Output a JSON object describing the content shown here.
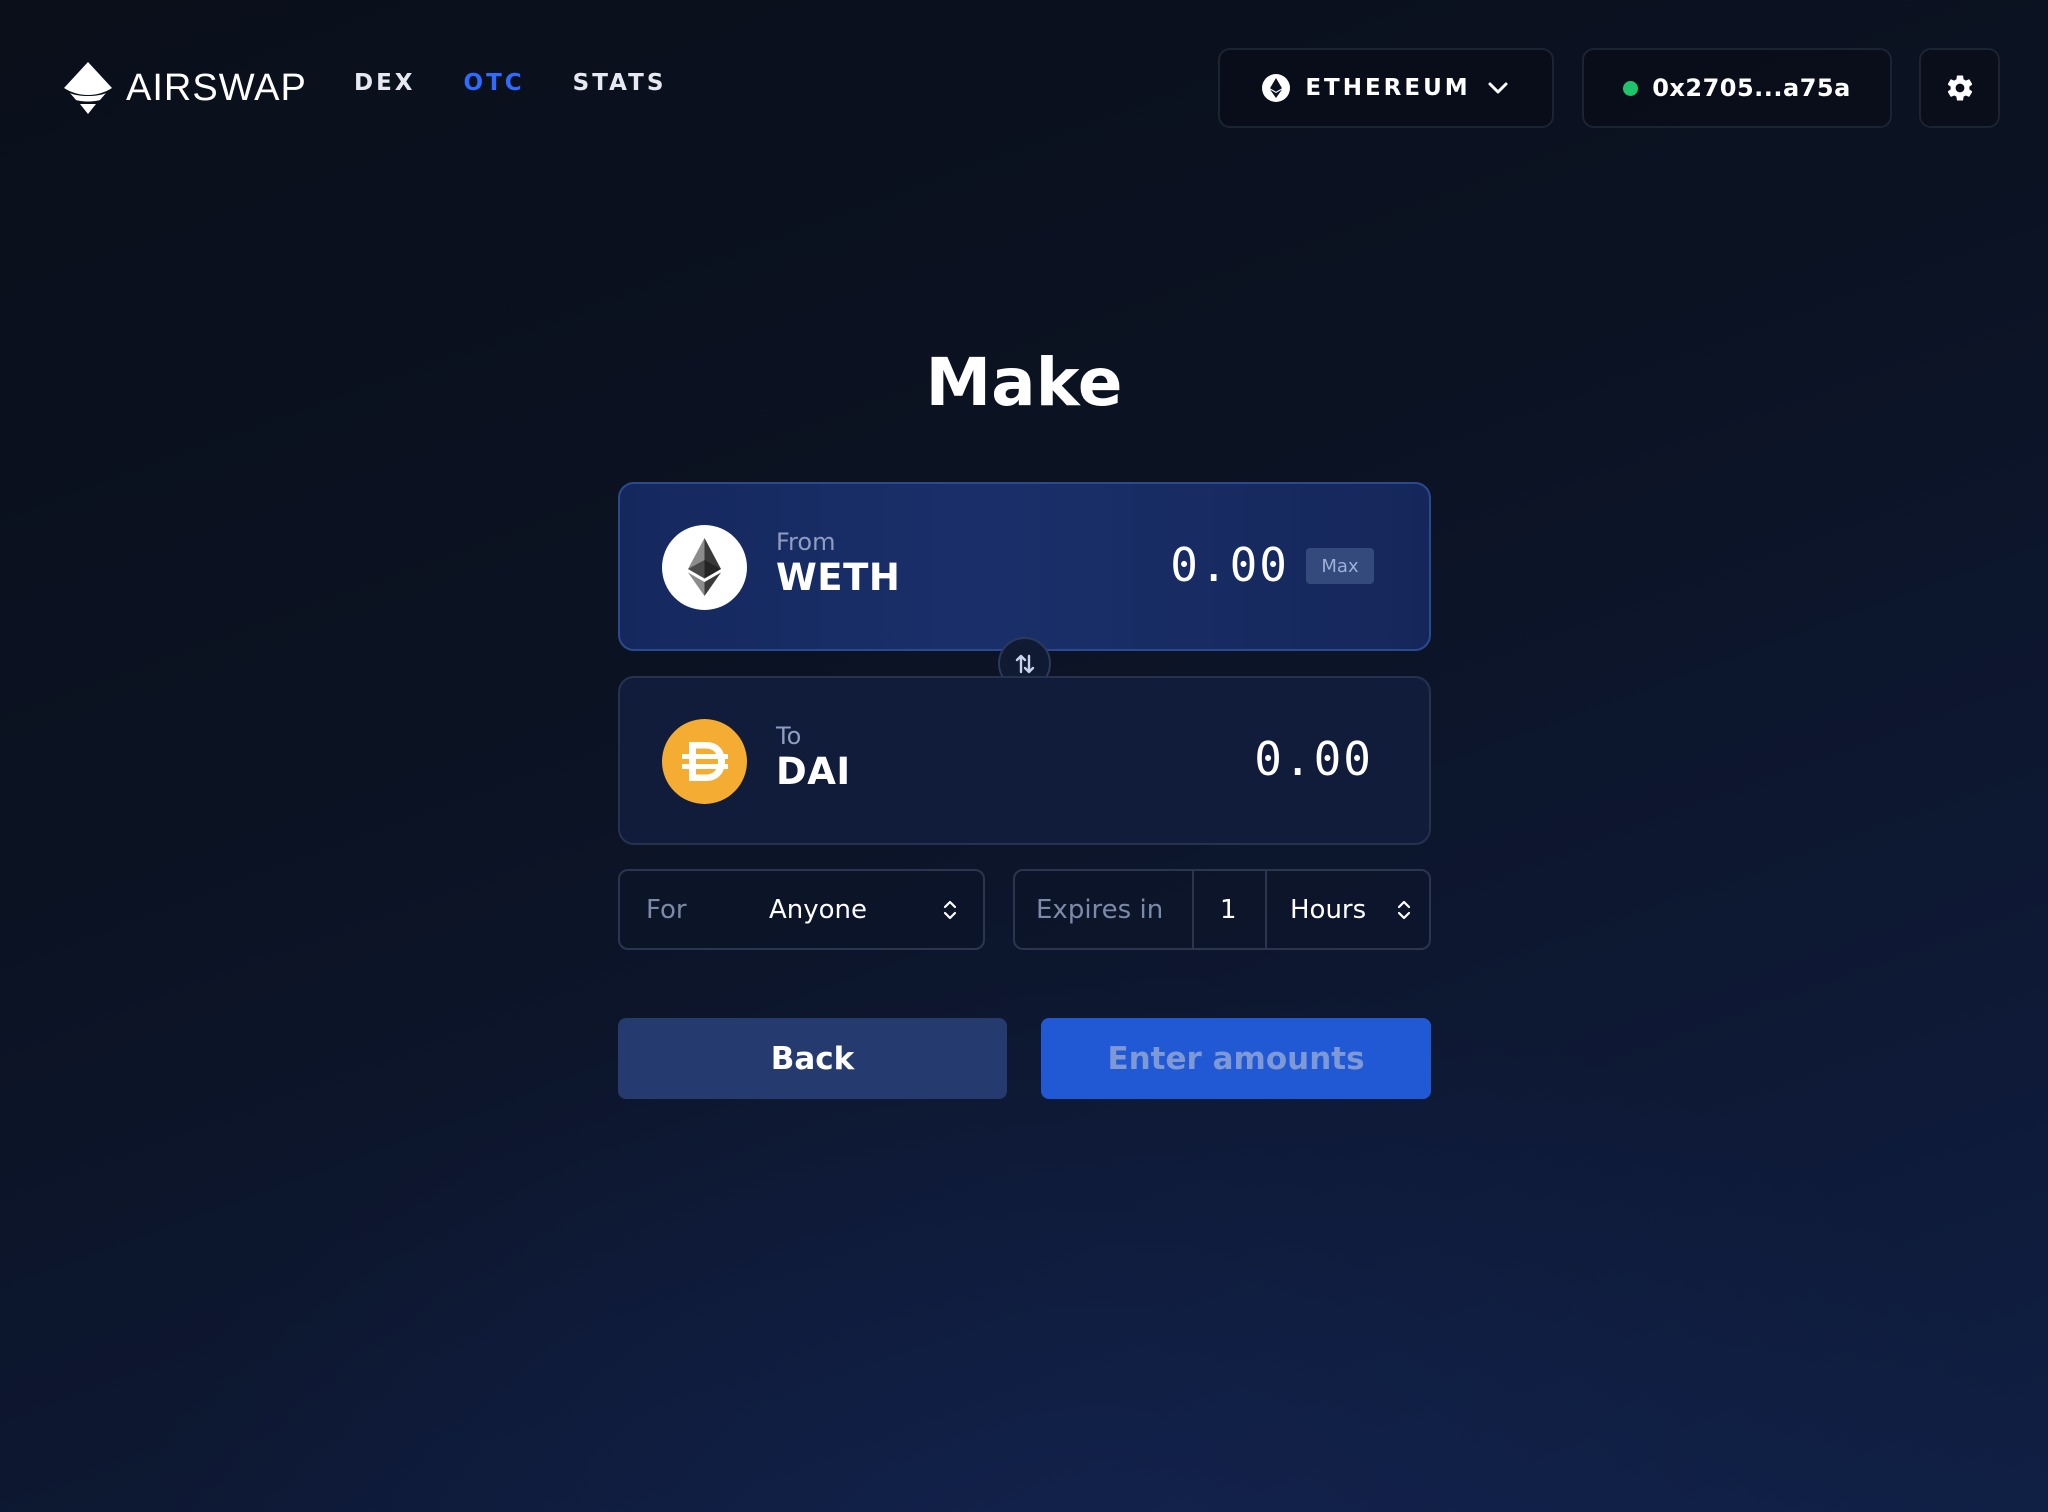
{
  "header": {
    "logo_text": "AIRSWAP",
    "nav": [
      {
        "label": "DEX",
        "active": false
      },
      {
        "label": "OTC",
        "active": true
      },
      {
        "label": "STATS",
        "active": false
      }
    ],
    "network": {
      "label": "ETHEREUM",
      "icon": "ethereum-icon"
    },
    "wallet": {
      "address": "0x2705...a75a",
      "status_color": "#1ec46b"
    },
    "settings_icon": "gear-icon"
  },
  "main": {
    "title": "Make",
    "from": {
      "direction": "From",
      "symbol": "WETH",
      "amount": "0.00",
      "max_label": "Max",
      "icon": "weth-token-icon"
    },
    "to": {
      "direction": "To",
      "symbol": "DAI",
      "amount": "0.00",
      "icon": "dai-token-icon"
    },
    "for_field": {
      "label": "For",
      "value": "Anyone"
    },
    "expires_field": {
      "label": "Expires in",
      "value": "1",
      "unit": "Hours"
    },
    "buttons": {
      "back": "Back",
      "submit": "Enter amounts"
    }
  },
  "colors": {
    "accent": "#2f6bff",
    "primary_button": "#2158d4",
    "secondary_button": "#253a6e",
    "dai": "#f4ac33"
  }
}
